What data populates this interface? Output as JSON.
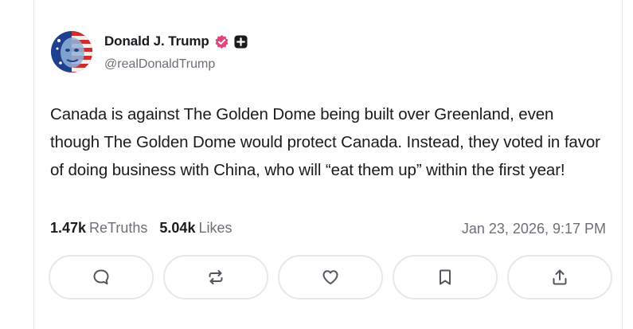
{
  "post": {
    "author": {
      "display_name": "Donald J. Trump",
      "handle": "@realDonaldTrump",
      "avatar_icon": "profile-avatar",
      "verified_color": "#e0457b"
    },
    "text": "Canada is against The Golden Dome being built over Greenland, even though The Golden Dome would protect Canada. Instead, they voted in favor of doing business with China, who will “eat them up” within the first year!",
    "stats": {
      "retruths_count": "1.47k",
      "retruths_label": "ReTruths",
      "likes_count": "5.04k",
      "likes_label": "Likes"
    },
    "timestamp": "Jan 23, 2026, 9:17 PM"
  },
  "actions": [
    {
      "name": "reply",
      "icon": "comment-icon"
    },
    {
      "name": "retruth",
      "icon": "repost-icon"
    },
    {
      "name": "like",
      "icon": "heart-icon"
    },
    {
      "name": "bookmark",
      "icon": "bookmark-icon"
    },
    {
      "name": "share",
      "icon": "share-icon"
    }
  ]
}
